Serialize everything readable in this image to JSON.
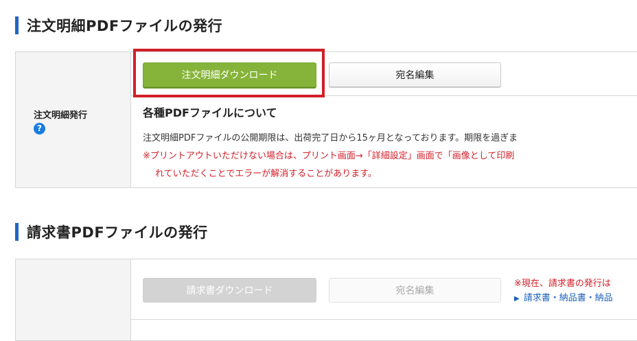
{
  "sections": [
    {
      "title": "注文明細PDFファイルの発行",
      "row_label": "注文明細発行",
      "help_icon": "question-circle-icon",
      "buttons": {
        "download": "注文明細ダウンロード",
        "address": "宛名編集"
      },
      "info": {
        "heading": "各種PDFファイルについて",
        "text": "注文明細PDFファイルの公開期限は、出荷完了日から15ヶ月となっております。期限を過ぎま",
        "warning_line1": "※プリントアウトいただけない場合は、プリント画面→「詳細設定」画面で「画像として印刷",
        "warning_line2": "れていただくことでエラーが解消することがあります。"
      }
    },
    {
      "title": "請求書PDFファイルの発行",
      "buttons": {
        "download": "請求書ダウンロード",
        "address": "宛名編集"
      },
      "notice": "※現在、請求書の発行は",
      "link": "請求書・納品書・納品",
      "link_icon": "triangle-right-icon"
    }
  ],
  "colors": {
    "accent_bar": "#2266c0",
    "primary_button": "#86b43a",
    "highlight_border": "#d0202a",
    "warning_text": "#d0202a",
    "link_text": "#1a5fb8"
  }
}
